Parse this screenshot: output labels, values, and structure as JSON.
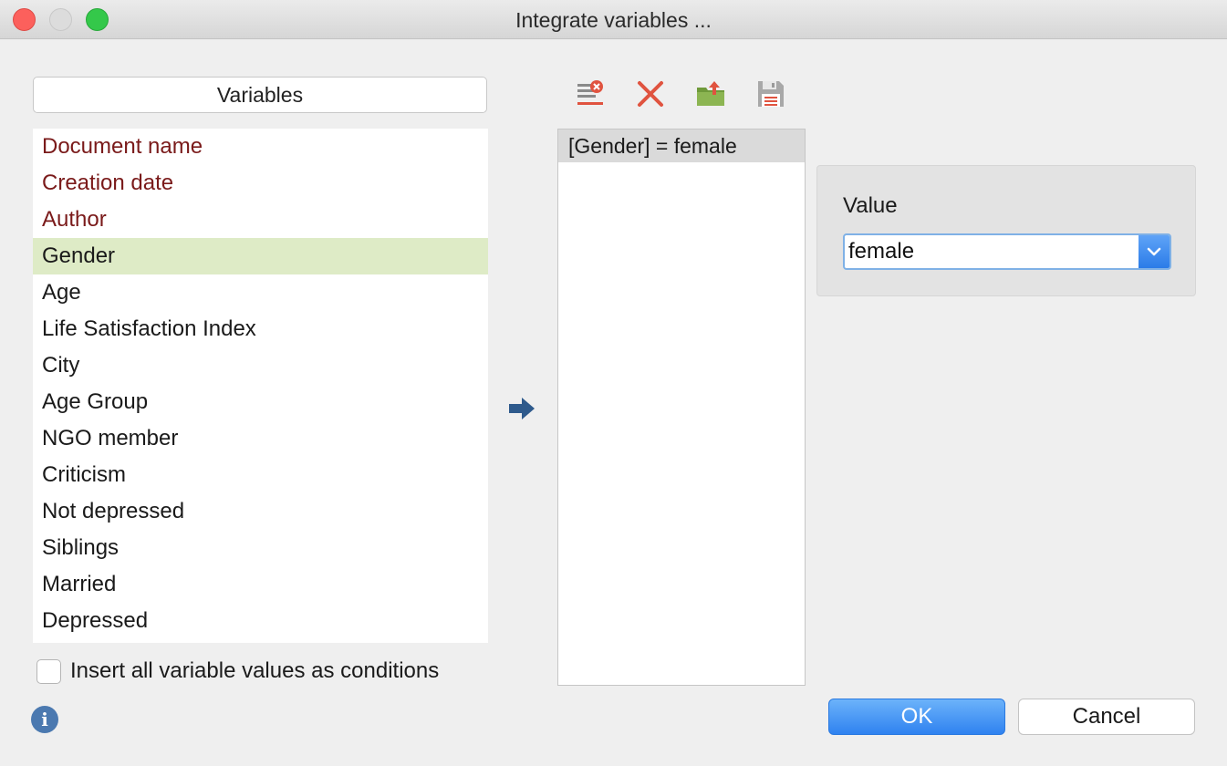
{
  "window": {
    "title": "Integrate variables ..."
  },
  "variables": {
    "header": "Variables",
    "items": [
      {
        "label": "Document name"
      },
      {
        "label": "Creation date"
      },
      {
        "label": "Author"
      },
      {
        "label": "Gender"
      },
      {
        "label": "Age"
      },
      {
        "label": "Life Satisfaction Index"
      },
      {
        "label": "City"
      },
      {
        "label": "Age Group"
      },
      {
        "label": "NGO member"
      },
      {
        "label": "Criticism"
      },
      {
        "label": "Not depressed"
      },
      {
        "label": "Siblings"
      },
      {
        "label": "Married"
      },
      {
        "label": "Depressed"
      }
    ],
    "selected": "Gender",
    "system_color": "#7a1a1a",
    "selected_color": "#deebc6"
  },
  "options": {
    "insert_all_label": "Insert all variable values as conditions",
    "insert_all_checked": false
  },
  "toolbar": {
    "icons": [
      "clear-list-icon",
      "delete-icon",
      "open-folder-icon",
      "save-icon"
    ]
  },
  "conditions": {
    "items": [
      "[Gender] = female"
    ]
  },
  "value_panel": {
    "label": "Value",
    "selected_value": "female"
  },
  "buttons": {
    "ok_label": "OK",
    "cancel_label": "Cancel"
  },
  "colors": {
    "accent": "#2f82f0",
    "delete": "#e0533f"
  }
}
